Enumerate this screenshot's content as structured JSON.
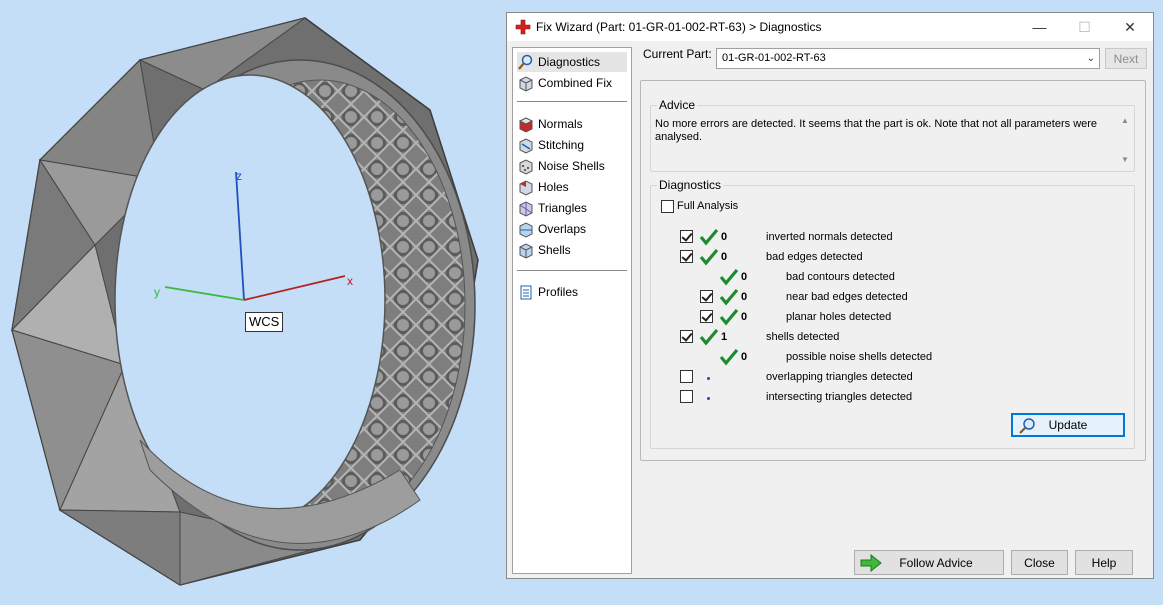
{
  "viewport": {
    "axis_x": "x",
    "axis_y": "y",
    "axis_z": "z",
    "wcs_label": "WCS"
  },
  "window": {
    "title": "Fix Wizard (Part: 01-GR-01-002-RT-63) > Diagnostics",
    "minimize_glyph": "—",
    "maximize_glyph": "☐",
    "close_glyph": "✕"
  },
  "sidebar": {
    "items": [
      {
        "label": "Diagnostics",
        "icon": "diagnostics-icon",
        "selected": true
      },
      {
        "label": "Combined Fix",
        "icon": "combined-fix-icon"
      },
      {
        "label": "Normals",
        "icon": "normals-icon"
      },
      {
        "label": "Stitching",
        "icon": "stitching-icon"
      },
      {
        "label": "Noise Shells",
        "icon": "noise-shells-icon"
      },
      {
        "label": "Holes",
        "icon": "holes-icon"
      },
      {
        "label": "Triangles",
        "icon": "triangles-icon"
      },
      {
        "label": "Overlaps",
        "icon": "overlaps-icon"
      },
      {
        "label": "Shells",
        "icon": "shells-icon"
      },
      {
        "label": "Profiles",
        "icon": "profiles-icon"
      }
    ]
  },
  "current_part": {
    "label": "Current Part:",
    "value": "01-GR-01-002-RT-63",
    "next_label": "Next"
  },
  "advice": {
    "title": "Advice",
    "text": "No more errors are detected. It seems that the part is ok. Note that not all parameters were analysed."
  },
  "diagnostics": {
    "title": "Diagnostics",
    "full_analysis_label": "Full Analysis",
    "full_analysis_checked": false,
    "rows": [
      {
        "count": "0",
        "label": "inverted normals detected",
        "checked": true
      },
      {
        "count": "0",
        "label": "bad edges detected",
        "checked": true
      },
      {
        "count": "0",
        "label": "bad contours detected"
      },
      {
        "count": "0",
        "label": "near bad edges detected",
        "checked": true
      },
      {
        "count": "0",
        "label": "planar holes detected",
        "checked": true
      },
      {
        "count": "1",
        "label": "shells detected",
        "checked": true
      },
      {
        "count": "0",
        "label": "possible noise shells detected"
      },
      {
        "count": "",
        "label": "overlapping triangles detected",
        "checked": false
      },
      {
        "count": "",
        "label": "intersecting triangles detected",
        "checked": false
      }
    ],
    "update_label": "Update"
  },
  "footer": {
    "follow_advice_label": "Follow Advice",
    "close_label": "Close",
    "help_label": "Help"
  },
  "colors": {
    "background": "#c3def6",
    "accent": "#0078d7",
    "tick_green": "#1e8a2e",
    "close_red": "#e81123"
  }
}
